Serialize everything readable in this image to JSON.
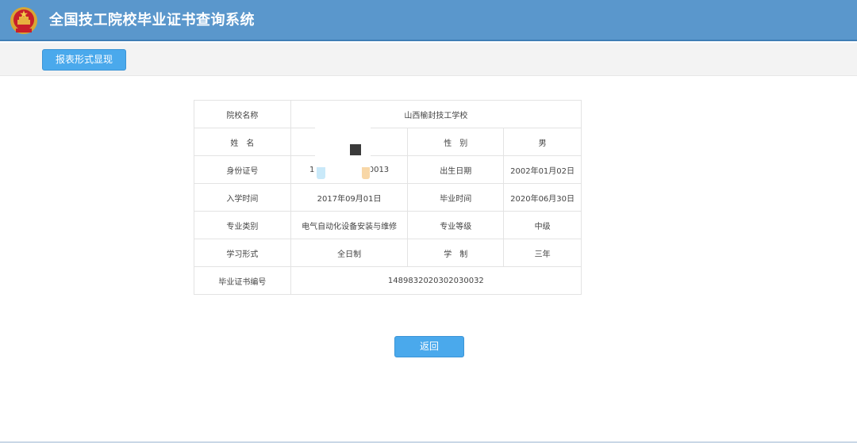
{
  "header": {
    "title": "全国技工院校毕业证书查询系统",
    "emblem_icon": "national-emblem-icon",
    "bg_color": "#5a97cc"
  },
  "toolbar": {
    "report_button": "报表形式显现"
  },
  "record": {
    "school_label": "院校名称",
    "school_value": "山西榆封技工学校",
    "name_label": "姓　名",
    "name_value": "",
    "gender_label": "性　别",
    "gender_value": "男",
    "id_label": "身份证号",
    "id_value_start": "1",
    "id_value_end": "0013",
    "birth_label": "出生日期",
    "birth_value": "2002年01月02日",
    "enroll_label": "入学时间",
    "enroll_value": "2017年09月01日",
    "grad_label": "毕业时间",
    "grad_value": "2020年06月30日",
    "major_label": "专业类别",
    "major_value": "电气自动化设备安装与维修",
    "level_label": "专业等级",
    "level_value": "中级",
    "mode_label": "学习形式",
    "mode_value": "全日制",
    "duration_label": "学　制",
    "duration_value": "三年",
    "cert_label": "毕业证书编号",
    "cert_value": "1489832020302030032"
  },
  "actions": {
    "back_button": "返回"
  },
  "colors": {
    "accent": "#4aa9ec",
    "border": "#e3e3e3"
  }
}
